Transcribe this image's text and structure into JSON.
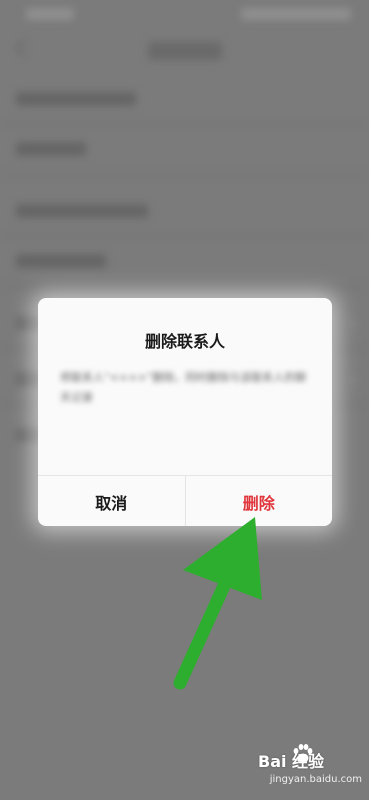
{
  "dialog": {
    "title": "删除联系人",
    "message": "将联系人“××××”删除，同时删除与该联系人的聊天记录",
    "cancel_label": "取消",
    "delete_label": "删除"
  },
  "watermark": {
    "logo_text": "Bai 经验",
    "url": "jingyan.baidu.com"
  },
  "colors": {
    "delete_red": "#e0353b",
    "arrow_green": "#2eae2e",
    "overlay": "#7b7b7b"
  },
  "icons": [
    "back-chevron-icon",
    "row-chevron-icon",
    "green-arrow-icon",
    "baidu-paw-icon"
  ]
}
